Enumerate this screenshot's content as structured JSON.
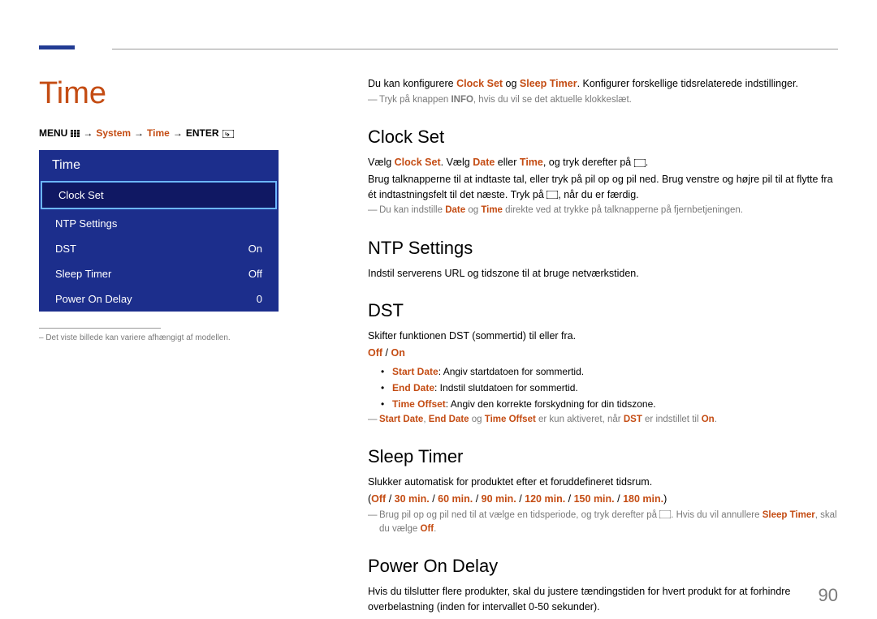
{
  "page_title": "Time",
  "breadcrumb": {
    "menu": "MENU",
    "arrow": "→",
    "system": "System",
    "time": "Time",
    "enter": "ENTER"
  },
  "menu": {
    "header": "Time",
    "items": [
      {
        "label": "Clock Set",
        "value": ""
      },
      {
        "label": "NTP Settings",
        "value": ""
      },
      {
        "label": "DST",
        "value": "On"
      },
      {
        "label": "Sleep Timer",
        "value": "Off"
      },
      {
        "label": "Power On Delay",
        "value": "0"
      }
    ]
  },
  "disclaimer": "– Det viste billede kan variere afhængigt af modellen.",
  "intro": {
    "prefix": "Du kan konfigurere ",
    "clockset": "Clock Set",
    "mid": " og ",
    "sleeptimer": "Sleep Timer",
    "suffix": ". Konfigurer forskellige tidsrelaterede indstillinger."
  },
  "intro_note": {
    "p1": "Tryk på knappen ",
    "info": "INFO",
    "p2": ", hvis du vil se det aktuelle klokkeslæt."
  },
  "clockset": {
    "heading": "Clock Set",
    "l1": {
      "a": "Vælg ",
      "b": "Clock Set",
      "c": ". Vælg ",
      "d": "Date",
      "e": " eller ",
      "f": "Time",
      "g": ", og tryk derefter på "
    },
    "l2": "Brug talknapperne til at indtaste tal, eller tryk på pil op og pil ned. Brug venstre og højre pil til at flytte fra ét indtastningsfelt til det næste. Tryk på ",
    "l2b": ", når du er færdig.",
    "note": {
      "a": "Du kan indstille ",
      "b": "Date",
      "c": " og ",
      "d": "Time",
      "e": " direkte ved at trykke på talknapperne på fjernbetjeningen."
    }
  },
  "ntp": {
    "heading": "NTP Settings",
    "body": "Indstil serverens URL og tidszone til at bruge netværkstiden."
  },
  "dst": {
    "heading": "DST",
    "body": "Skifter funktionen DST (sommertid) til eller fra.",
    "off": "Off",
    "sep": " / ",
    "on": "On",
    "b1a": "Start Date",
    "b1b": ": Angiv startdatoen for sommertid.",
    "b2a": "End Date",
    "b2b": ": Indstil slutdatoen for sommertid.",
    "b3a": "Time Offset",
    "b3b": ": Angiv den korrekte forskydning for din tidszone.",
    "note": {
      "a": "Start Date",
      "b": ", ",
      "c": "End Date",
      "d": " og ",
      "e": "Time Offset",
      "f": " er kun aktiveret, når ",
      "g": "DST",
      "h": " er indstillet til ",
      "i": "On",
      "j": "."
    }
  },
  "sleep": {
    "heading": "Sleep Timer",
    "body": "Slukker automatisk for produktet efter et foruddefineret tidsrum.",
    "opts": {
      "open": "(",
      "off": "Off",
      "s": " / ",
      "o1": "30 min.",
      "o2": "60 min.",
      "o3": "90 min.",
      "o4": "120 min.",
      "o5": "150 min.",
      "o6": "180 min.",
      "close": ")"
    },
    "note": {
      "a": "Brug pil op og pil ned til at vælge en tidsperiode, og tryk derefter på ",
      "b": ". Hvis du vil annullere ",
      "c": "Sleep Timer",
      "d": ", skal du vælge ",
      "e": "Off",
      "f": "."
    }
  },
  "pod": {
    "heading": "Power On Delay",
    "body": "Hvis du tilslutter flere produkter, skal du justere tændingstiden for hvert product for at forhindre overbelastning (inden for intervallet 0-50 sekunder).",
    "body_fixed": "Hvis du tilslutter flere produkter, skal du justere tændingstiden for hvert produkt for at forhindre overbelastning (inden for intervallet 0-50 sekunder)."
  },
  "page_number": "90"
}
